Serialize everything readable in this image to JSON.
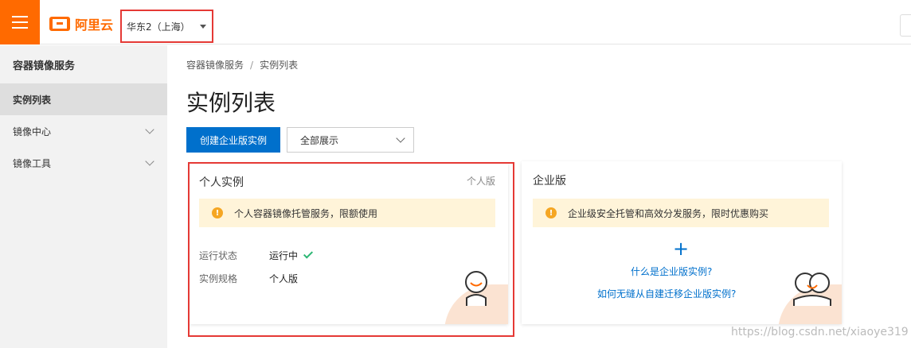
{
  "header": {
    "logo_text": "阿里云",
    "region_label": "华东2（上海）",
    "accent": "#ff6a00"
  },
  "sidebar": {
    "title": "容器镜像服务",
    "items": [
      {
        "label": "实例列表",
        "active": true
      },
      {
        "label": "镜像中心",
        "expandable": true
      },
      {
        "label": "镜像工具",
        "expandable": true
      }
    ]
  },
  "breadcrumb": [
    "容器镜像服务",
    "实例列表"
  ],
  "page_title": "实例列表",
  "toolbar": {
    "create_label": "创建企业版实例",
    "filter_selected": "全部展示"
  },
  "cards": {
    "personal": {
      "title": "个人实例",
      "tag": "个人版",
      "notice": "个人容器镜像托管服务，限额使用",
      "status_key": "运行状态",
      "status_value": "运行中",
      "spec_key": "实例规格",
      "spec_value": "个人版"
    },
    "enterprise": {
      "title": "企业版",
      "notice": "企业级安全托管和高效分发服务，限时优惠购买",
      "plus": "+",
      "link1": "什么是企业版实例?",
      "link2": "如何无缝从自建迁移企业版实例?"
    }
  },
  "watermark": "https://blog.csdn.net/xiaoye319",
  "colors": {
    "primary": "#0070cc",
    "highlight": "#e53935",
    "notice_bg": "#fff4d9",
    "success": "#2bb673"
  }
}
